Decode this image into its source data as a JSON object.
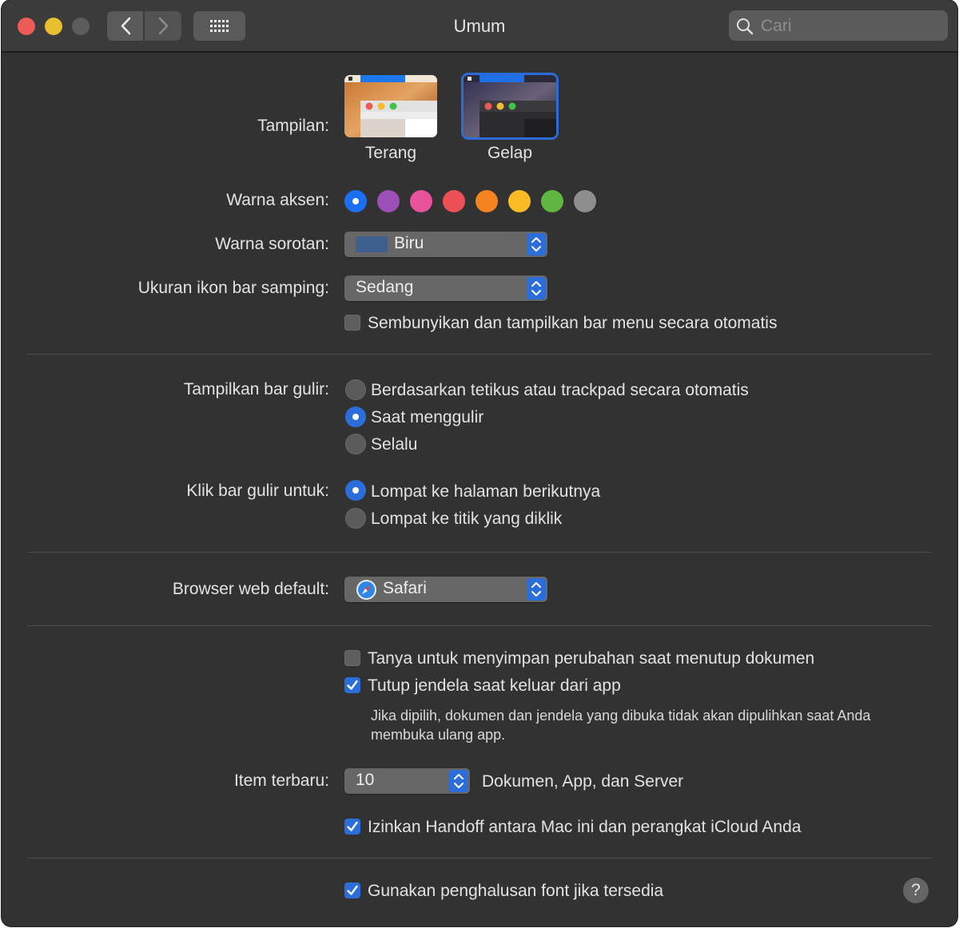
{
  "window": {
    "title": "Umum"
  },
  "toolbar": {
    "search_placeholder": "Cari"
  },
  "appearance": {
    "label": "Tampilan:",
    "options": [
      {
        "label": "Terang"
      },
      {
        "label": "Gelap"
      }
    ],
    "selected": "Gelap"
  },
  "accent": {
    "label": "Warna aksen:",
    "colors": [
      "#1d6ff2",
      "#9c4fb6",
      "#e7529b",
      "#ed4f57",
      "#f5831f",
      "#f8bb25",
      "#5fb640",
      "#8e8e8e"
    ],
    "selected_index": 0
  },
  "highlight": {
    "label": "Warna sorotan:",
    "value": "Biru",
    "swatch_color": "#3f5f8f"
  },
  "sidebar_icon_size": {
    "label": "Ukuran ikon bar samping:",
    "value": "Sedang"
  },
  "auto_hide_menu": {
    "label": "Sembunyikan dan tampilkan bar menu secara otomatis",
    "checked": false
  },
  "show_scrollbars": {
    "label": "Tampilkan bar gulir:",
    "options": [
      {
        "label": "Berdasarkan tetikus atau trackpad secara otomatis",
        "selected": false
      },
      {
        "label": "Saat menggulir",
        "selected": true
      },
      {
        "label": "Selalu",
        "selected": false
      }
    ]
  },
  "click_scrollbar": {
    "label": "Klik bar gulir untuk:",
    "options": [
      {
        "label": "Lompat ke halaman berikutnya",
        "selected": true
      },
      {
        "label": "Lompat ke titik yang diklik",
        "selected": false
      }
    ]
  },
  "default_browser": {
    "label": "Browser web default:",
    "value": "Safari"
  },
  "ask_save": {
    "label": "Tanya untuk menyimpan perubahan saat menutup dokumen",
    "checked": false
  },
  "close_windows": {
    "label": "Tutup jendela saat keluar dari app",
    "checked": true,
    "note_line1": "Jika dipilih, dokumen dan jendela yang dibuka tidak akan dipulihkan saat Anda",
    "note_line2": "membuka ulang app."
  },
  "recent_items": {
    "label": "Item terbaru:",
    "value": "10",
    "suffix": "Dokumen, App, dan Server"
  },
  "handoff": {
    "label": "Izinkan Handoff antara Mac ini dan perangkat iCloud Anda",
    "checked": true
  },
  "font_smoothing": {
    "label": "Gunakan penghalusan font jika tersedia",
    "checked": true
  },
  "help": {
    "label": "?"
  }
}
